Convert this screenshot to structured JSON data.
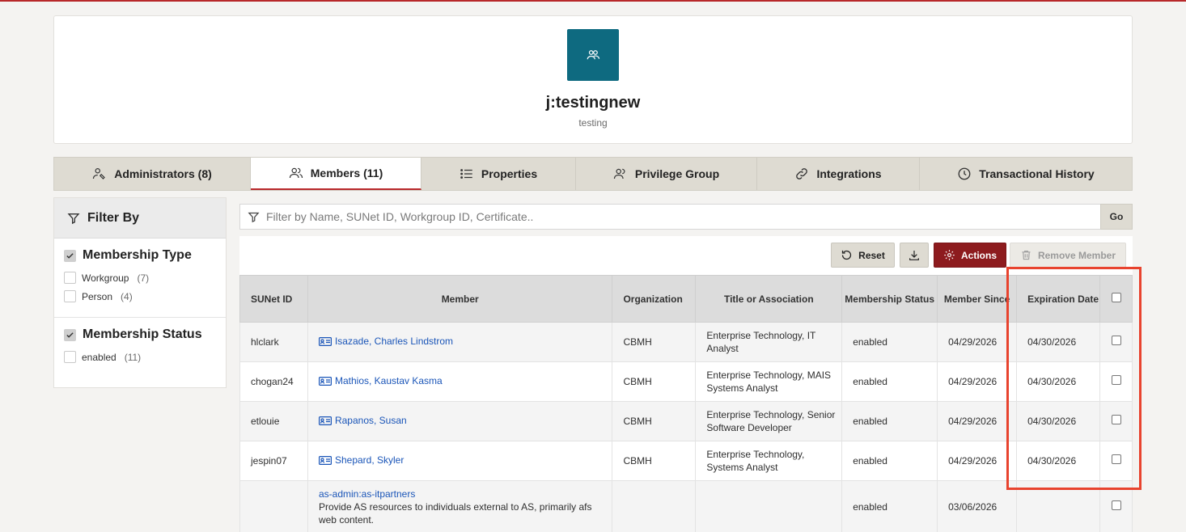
{
  "group": {
    "title": "j:testingnew",
    "subtitle": "testing",
    "icon": "group-icon"
  },
  "tabs": [
    {
      "label": "Administrators (8)",
      "icon": "admin-icon"
    },
    {
      "label": "Members (11)",
      "icon": "members-icon",
      "active": true
    },
    {
      "label": "Properties",
      "icon": "list-icon"
    },
    {
      "label": "Privilege Group",
      "icon": "user-icon"
    },
    {
      "label": "Integrations",
      "icon": "link-icon"
    },
    {
      "label": "Transactional History",
      "icon": "clock-icon"
    }
  ],
  "filter": {
    "title": "Filter By",
    "facets": [
      {
        "title": "Membership Type",
        "options": [
          {
            "label": "Workgroup",
            "count": "(7)"
          },
          {
            "label": "Person",
            "count": "(4)"
          }
        ]
      },
      {
        "title": "Membership Status",
        "options": [
          {
            "label": "enabled",
            "count": "(11)"
          }
        ]
      }
    ]
  },
  "search": {
    "placeholder": "Filter by Name, SUNet ID, Workgroup ID, Certificate..",
    "go_label": "Go"
  },
  "toolbar": {
    "reset_label": "Reset",
    "actions_label": "Actions",
    "remove_label": "Remove Member"
  },
  "table": {
    "headers": [
      "SUNet ID",
      "Member",
      "Organization",
      "Title or Association",
      "Membership Status",
      "Member Since",
      "Expiration Date"
    ],
    "rows": [
      {
        "sunet": "hlclark",
        "member": "Isazade, Charles Lindstrom",
        "org": "CBMH",
        "title": "Enterprise Technology, IT Analyst",
        "status": "enabled",
        "since": "04/29/2026",
        "expires": "04/30/2026"
      },
      {
        "sunet": "chogan24",
        "member": "Mathios, Kaustav Kasma",
        "org": "CBMH",
        "title": "Enterprise Technology, MAIS Systems Analyst",
        "status": "enabled",
        "since": "04/29/2026",
        "expires": "04/30/2026"
      },
      {
        "sunet": "etlouie",
        "member": "Rapanos, Susan",
        "org": "CBMH",
        "title": "Enterprise Technology, Senior Software Developer",
        "status": "enabled",
        "since": "04/29/2026",
        "expires": "04/30/2026"
      },
      {
        "sunet": "jespin07",
        "member": "Shepard, Skyler",
        "org": "CBMH",
        "title": "Enterprise Technology, Systems Analyst",
        "status": "enabled",
        "since": "04/29/2026",
        "expires": "04/30/2026"
      },
      {
        "sunet": "",
        "member": "as-admin:as-itpartners",
        "member_desc": "Provide AS resources to individuals external to AS, primarily afs web content.",
        "org": "",
        "title": "",
        "status": "enabled",
        "since": "03/06/2026",
        "expires": ""
      }
    ]
  },
  "colors": {
    "accent": "#b8282a",
    "actions_bg": "#8d1b1e",
    "icon_bg": "#0e6a80",
    "link": "#1a55b8",
    "highlight": "#e8432e"
  }
}
